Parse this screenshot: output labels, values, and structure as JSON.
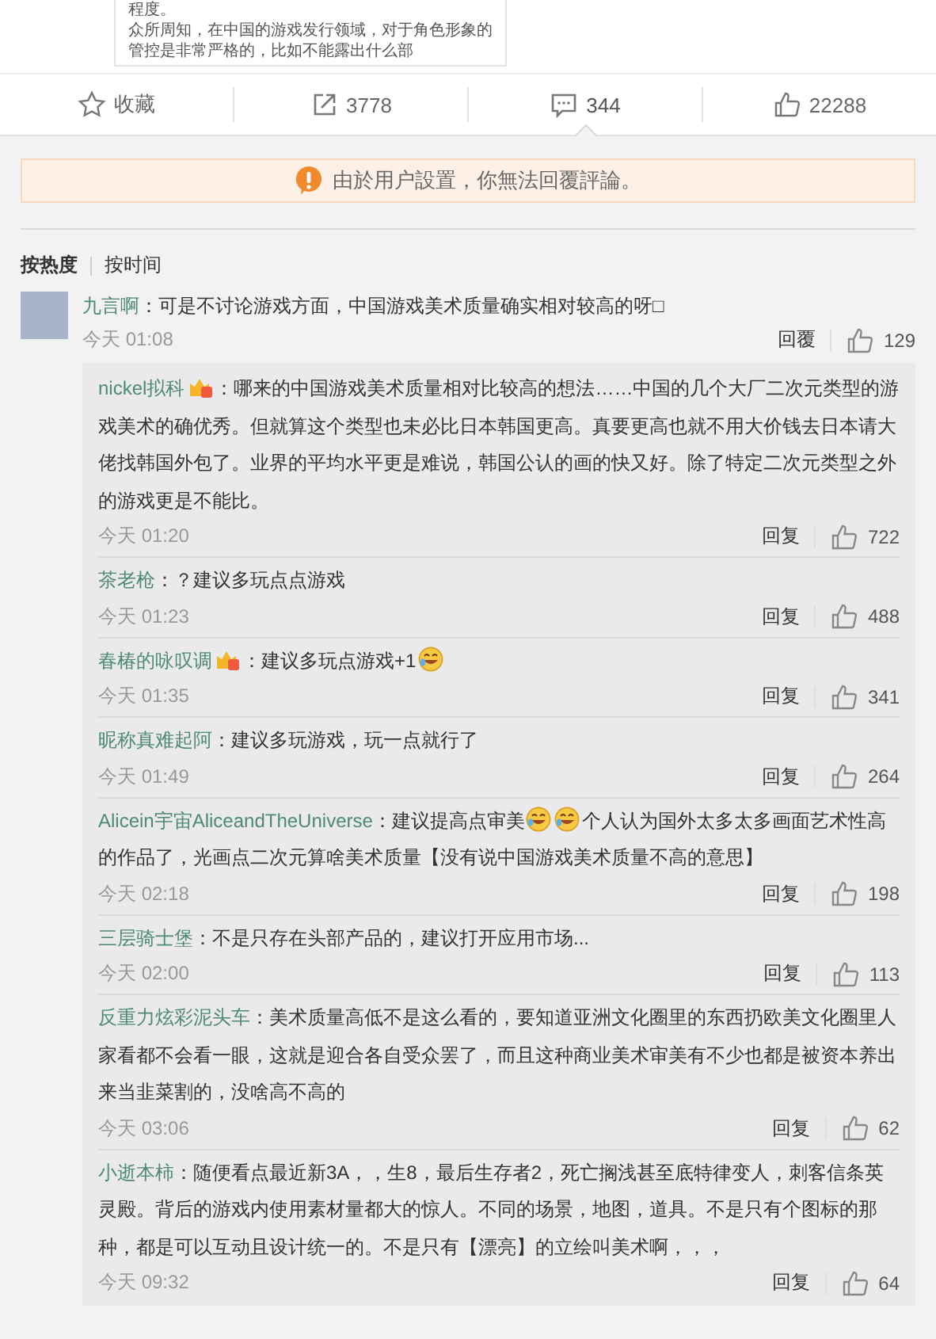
{
  "article_snippet": {
    "lines": [
      "程度。",
      "众所周知，在中国的游戏发行领域，对于角色形象的管控是非常严格的，比如不能露出什么部"
    ]
  },
  "actions": [
    {
      "kind": "favorite",
      "label": "收藏",
      "selected": false
    },
    {
      "kind": "share",
      "label": "3778",
      "selected": false
    },
    {
      "kind": "comment",
      "label": "344",
      "selected": true
    },
    {
      "kind": "like",
      "label": "22288",
      "selected": false
    }
  ],
  "notice": "由於用户設置，你無法回覆評論。",
  "sort_tabs": [
    {
      "label": "按热度",
      "selected": true
    },
    {
      "label": "按时间",
      "selected": false
    }
  ],
  "top_comment": {
    "user": "九言啊",
    "content": [
      {
        "kind": "text",
        "text": "：可是不讨论游戏方面，中国游戏美术质量确实相对较高的呀□"
      }
    ],
    "time": "今天 01:08",
    "reply": "回覆",
    "likes": "129"
  },
  "replies": [
    {
      "user": "nickel拟科",
      "content": [
        {
          "kind": "badge"
        },
        {
          "kind": "text",
          "text": "：哪来的中国游戏美术质量相对比较高的想法……中国的几个大厂二次元类型的游戏美术的确优秀。但就算这个类型也未必比日本韩国更高。真要更高也就不用大价钱去日本请大佬找韩国外包了。业界的平均水平更是难说，韩国公认的画的快又好。除了特定二次元类型之外的游戏更是不能比。"
        }
      ],
      "time": "今天 01:20",
      "reply": "回复",
      "likes": "722"
    },
    {
      "user": "茶老枪",
      "content": [
        {
          "kind": "text",
          "text": "：？建议多玩点点游戏"
        }
      ],
      "time": "今天 01:23",
      "reply": "回复",
      "likes": "488"
    },
    {
      "user": "春椿的咏叹调",
      "content": [
        {
          "kind": "badge"
        },
        {
          "kind": "text",
          "text": "：建议多玩点游戏+1"
        },
        {
          "kind": "emoji"
        }
      ],
      "time": "今天 01:35",
      "reply": "回复",
      "likes": "341"
    },
    {
      "user": "昵称真难起阿",
      "content": [
        {
          "kind": "text",
          "text": "：建议多玩游戏，玩一点就行了"
        }
      ],
      "time": "今天 01:49",
      "reply": "回复",
      "likes": "264"
    },
    {
      "user": "Alicein宇宙AliceandTheUniverse",
      "content": [
        {
          "kind": "text",
          "text": "：建议提高点审美"
        },
        {
          "kind": "emoji"
        },
        {
          "kind": "emoji"
        },
        {
          "kind": "text",
          "text": "个人认为国外太多太多画面艺术性高的作品了，光画点二次元算啥美术质量【没有说中国游戏美术质量不高的意思】"
        }
      ],
      "time": "今天 02:18",
      "reply": "回复",
      "likes": "198"
    },
    {
      "user": "三层骑士堡",
      "content": [
        {
          "kind": "text",
          "text": "：不是只存在头部产品的，建议打开应用市场..."
        }
      ],
      "time": "今天 02:00",
      "reply": "回复",
      "likes": "113"
    },
    {
      "user": "反重力炫彩泥头车",
      "content": [
        {
          "kind": "text",
          "text": "：美术质量高低不是这么看的，要知道亚洲文化圈里的东西扔欧美文化圈里人家看都不会看一眼，这就是迎合各自受众罢了，而且这种商业美术审美有不少也都是被资本养出来当韭菜割的，没啥高不高的"
        }
      ],
      "time": "今天 03:06",
      "reply": "回复",
      "likes": "62"
    },
    {
      "user": "小逝本柿",
      "content": [
        {
          "kind": "text",
          "text": "：随便看点最近新3A，，生8，最后生存者2，死亡搁浅甚至底特律变人，刺客信条英灵殿。背后的游戏内使用素材量都大的惊人。不同的场景，地图，道具。不是只有个图标的那种，都是可以互动且设计统一的。不是只有【漂亮】的立绘叫美术啊，，，"
        }
      ],
      "time": "今天 09:32",
      "reply": "回复",
      "likes": "64"
    }
  ]
}
